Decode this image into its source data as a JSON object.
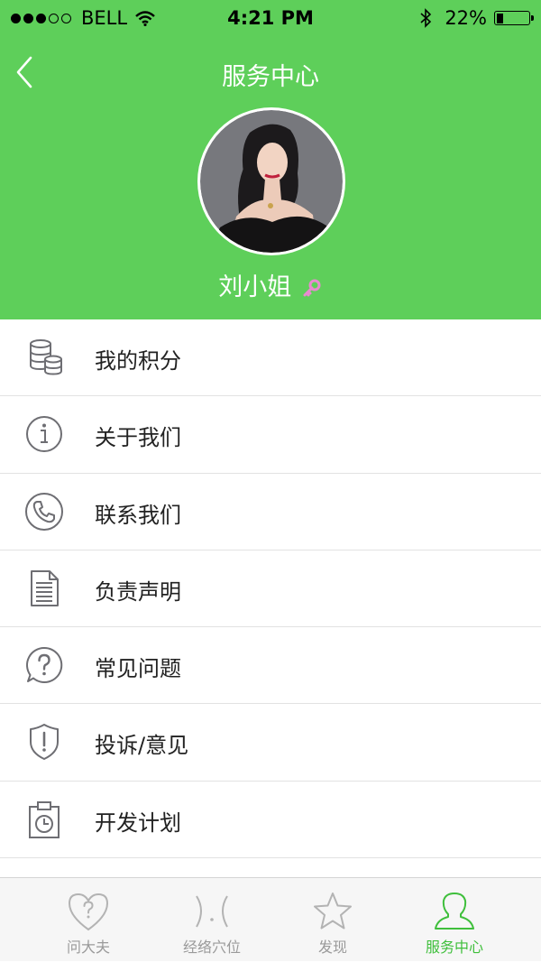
{
  "status_bar": {
    "carrier": "BELL",
    "time": "4:21 PM",
    "battery_percent": "22%",
    "battery_level": 0.22,
    "signal_bars": 3
  },
  "nav": {
    "title": "服务中心",
    "back_icon": "chevron-left-icon"
  },
  "profile": {
    "name": "刘小姐",
    "badge_icon": "key-icon",
    "badge_color": "#e98ad0"
  },
  "menu": [
    {
      "label": "我的积分",
      "icon": "coins-icon"
    },
    {
      "label": "关于我们",
      "icon": "info-icon"
    },
    {
      "label": "联系我们",
      "icon": "phone-icon"
    },
    {
      "label": "负责声明",
      "icon": "document-icon"
    },
    {
      "label": "常见问题",
      "icon": "question-bubble-icon"
    },
    {
      "label": "投诉/意见",
      "icon": "shield-alert-icon"
    },
    {
      "label": "开发计划",
      "icon": "clipboard-clock-icon"
    }
  ],
  "tabs": [
    {
      "label": "问大夫",
      "icon": "heart-question-icon",
      "active": false
    },
    {
      "label": "经络穴位",
      "icon": "meridian-face-icon",
      "active": false
    },
    {
      "label": "发现",
      "icon": "star-icon",
      "active": false
    },
    {
      "label": "服务中心",
      "icon": "user-icon",
      "active": true
    }
  ],
  "colors": {
    "header_green": "#5ecf5a",
    "active_tab": "#3fbf3c",
    "inactive_tab": "#9a9a9a",
    "icon_gray": "#6e6e73"
  }
}
